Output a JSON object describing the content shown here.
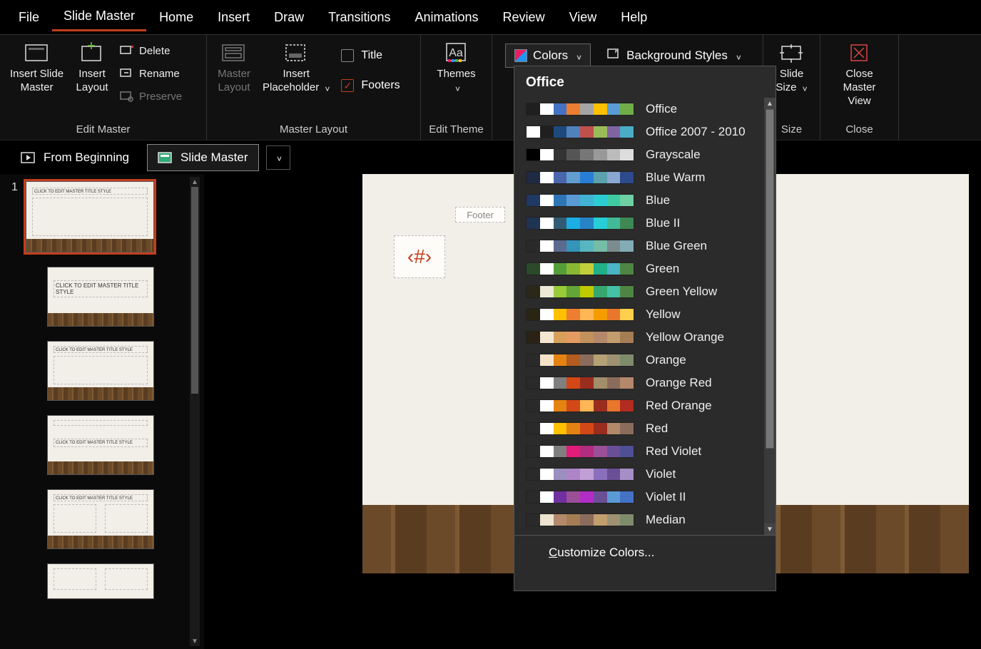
{
  "menubar": {
    "items": [
      "File",
      "Slide Master",
      "Home",
      "Insert",
      "Draw",
      "Transitions",
      "Animations",
      "Review",
      "View",
      "Help"
    ],
    "active_index": 1
  },
  "ribbon": {
    "groups": {
      "edit_master": {
        "label": "Edit Master",
        "insert_slide_master": "Insert Slide\nMaster",
        "insert_layout": "Insert\nLayout",
        "delete": "Delete",
        "rename": "Rename",
        "preserve": "Preserve"
      },
      "master_layout": {
        "label": "Master Layout",
        "master_layout_btn": "Master\nLayout",
        "insert_placeholder": "Insert\nPlaceholder",
        "title_chk": "Title",
        "footers_chk": "Footers"
      },
      "edit_theme": {
        "label": "Edit Theme",
        "themes": "Themes"
      },
      "background": {
        "colors": "Colors",
        "background_styles": "Background Styles"
      },
      "size": {
        "label": "Size",
        "slide_size": "Slide\nSize"
      },
      "close": {
        "label": "Close",
        "close_master": "Close\nMaster View"
      }
    }
  },
  "sec_toolbar": {
    "from_beginning": "From Beginning",
    "slide_master": "Slide Master"
  },
  "thumbs": {
    "master_index": "1",
    "master_title_text": "CLICK TO EDIT MASTER TITLE STYLE",
    "layout_title_text": "CLICK TO EDIT MASTER TITLE STYLE"
  },
  "canvas": {
    "footer_label": "Footer",
    "slide_number_placeholder": "‹#›"
  },
  "colors_dropdown": {
    "header": "Office",
    "rows": [
      {
        "name": "Office",
        "colors": [
          "#1f1f1f",
          "#ffffff",
          "#4472c4",
          "#ed7d31",
          "#a5a5a5",
          "#ffc000",
          "#5b9bd5",
          "#70ad47"
        ]
      },
      {
        "name": "Office 2007 - 2010",
        "colors": [
          "#ffffff",
          "#1f1f1f",
          "#1f497d",
          "#4f81bd",
          "#c0504d",
          "#9bbb59",
          "#8064a2",
          "#4bacc6"
        ]
      },
      {
        "name": "Grayscale",
        "colors": [
          "#000000",
          "#ffffff",
          "#333333",
          "#555555",
          "#777777",
          "#999999",
          "#bbbbbb",
          "#dddddd"
        ]
      },
      {
        "name": "Blue Warm",
        "colors": [
          "#1f2a44",
          "#ffffff",
          "#4a66ac",
          "#629dd1",
          "#297fd5",
          "#5aa2ae",
          "#8aa8d0",
          "#2c4a8c"
        ]
      },
      {
        "name": "Blue",
        "colors": [
          "#1f3864",
          "#ffffff",
          "#2e75b6",
          "#5b9bd5",
          "#42b3d5",
          "#2cccd3",
          "#3fcba2",
          "#6fd0a5"
        ]
      },
      {
        "name": "Blue II",
        "colors": [
          "#1f3352",
          "#ffffff",
          "#335b74",
          "#1cade4",
          "#2683c6",
          "#27ced7",
          "#42ba97",
          "#3e8853"
        ]
      },
      {
        "name": "Blue Green",
        "colors": [
          "#2a2a2a",
          "#ffffff",
          "#5b6b8f",
          "#3494ba",
          "#58b6c0",
          "#75bda7",
          "#7a8c8e",
          "#84acb6"
        ]
      },
      {
        "name": "Green",
        "colors": [
          "#2a4a2a",
          "#ffffff",
          "#549e39",
          "#8ab833",
          "#c0cf3a",
          "#21b087",
          "#4ab5c4",
          "#4e8542"
        ]
      },
      {
        "name": "Green Yellow",
        "colors": [
          "#2a2819",
          "#ece9d6",
          "#99cb38",
          "#63a537",
          "#bfca02",
          "#37a76f",
          "#44c1a3",
          "#4e8542"
        ]
      },
      {
        "name": "Yellow",
        "colors": [
          "#2a2414",
          "#ffffff",
          "#ffc000",
          "#ed7d31",
          "#ffb655",
          "#f59c00",
          "#e8762c",
          "#ffcf4d"
        ]
      },
      {
        "name": "Yellow Orange",
        "colors": [
          "#2a2214",
          "#f4e7d2",
          "#d7a05a",
          "#e49b62",
          "#c2915c",
          "#b4886a",
          "#c29d6d",
          "#a47d54"
        ]
      },
      {
        "name": "Orange",
        "colors": [
          "#2a2a2a",
          "#f4e3c8",
          "#e48312",
          "#b25d1f",
          "#8b6c5c",
          "#b4a176",
          "#9e9273",
          "#7f8c6c"
        ]
      },
      {
        "name": "Orange Red",
        "colors": [
          "#2a2a2a",
          "#ffffff",
          "#7f7f7f",
          "#d34817",
          "#9b2d1f",
          "#a28e6a",
          "#8b6c5c",
          "#b4886a"
        ]
      },
      {
        "name": "Red Orange",
        "colors": [
          "#2a2a2a",
          "#ffffff",
          "#e48312",
          "#d34817",
          "#ffb655",
          "#9b2d1f",
          "#e8762c",
          "#b22c1f"
        ]
      },
      {
        "name": "Red",
        "colors": [
          "#2a2a2a",
          "#ffffff",
          "#ffc000",
          "#e48312",
          "#d34817",
          "#9b2d1f",
          "#b4886a",
          "#8b6c5c"
        ]
      },
      {
        "name": "Red Violet",
        "colors": [
          "#2a2a2a",
          "#ffffff",
          "#7f7f7f",
          "#e31c79",
          "#b22c7f",
          "#9b4f96",
          "#6b4f96",
          "#4f4f96"
        ]
      },
      {
        "name": "Violet",
        "colors": [
          "#2a2a2a",
          "#ffffff",
          "#9b8fc0",
          "#ad84c6",
          "#c19fd6",
          "#8a6fbd",
          "#6b4f96",
          "#a58fc6"
        ]
      },
      {
        "name": "Violet II",
        "colors": [
          "#2a2a2a",
          "#ffffff",
          "#7030a0",
          "#9b4f96",
          "#b22cc6",
          "#6b4f96",
          "#5b9bd5",
          "#4472c4"
        ]
      },
      {
        "name": "Median",
        "colors": [
          "#2a2a2a",
          "#ece3d0",
          "#b4886a",
          "#a47d54",
          "#8b6c5c",
          "#c29d6d",
          "#9e9273",
          "#7f8c6c"
        ]
      }
    ],
    "customize": "Customize Colors..."
  }
}
